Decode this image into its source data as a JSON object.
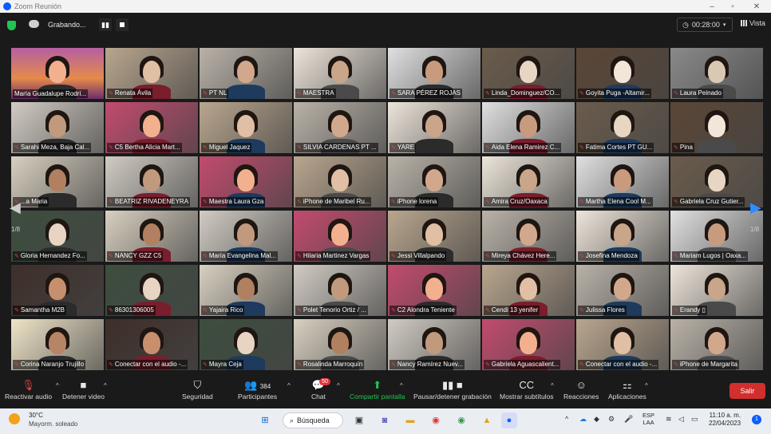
{
  "window": {
    "title": "Zoom Reunión"
  },
  "topbar": {
    "recording_label": "Grabando...",
    "pause_icon": "▮▮",
    "timer": "00:28:00",
    "view_label": "Vista"
  },
  "pager": {
    "left": "1/8",
    "right": "1/8"
  },
  "participants": [
    "María Guadalupe Rodrí...",
    "Renata Ávila",
    "PT NL",
    "MAESTRA",
    "SARA PÉREZ ROJAS",
    "Linda_Dominguez/CO...",
    "Goyita Puga -Altamir...",
    "Laura Peinado",
    "Sarahi Meza, Baja Cal...",
    "C5 Bertha Alicia Mart...",
    "Miguel Jaquez",
    "SILVIA CARDENAS PT ...",
    "YARE",
    "Aida Elena Ramirez C...",
    "Fatima Cortes PT  GU...",
    "Pina",
    "...a Maria",
    "BEATRIZ RIVADENEYRA",
    "Maestra Laura Gza",
    "iPhone de Maribel Ru...",
    "iPhone lorena",
    "Amira Cruz/Oaxaca",
    "Martha Elena Cool M...",
    "Gabriela Cruz Gutier...",
    "Gloria Hernandez Fo...",
    "NANCY GZZ C5",
    "María Evangelina Mal...",
    "Hilaria Martinez Vargas",
    "Jessi Villalpando",
    "Mireya Chávez  Here...",
    "Josefina Mendoza",
    "Mariam Lugos | Oaxa...",
    "Samantha M2B",
    "86301306005",
    "Yajaira Rico",
    "Polet Tenorio Ortiz / ...",
    "C2 Alondra Teniente",
    "Cendi 13 yenifer",
    "Julissa Flores",
    "Erandy ▯",
    "Corina Naranjo Trujillo",
    "Conectar con el audio -...",
    "Mayra Ceja",
    "Rosalinda Marroquín",
    "Nancy Ramírez Nuev...",
    "Gabriela Aguascalient...",
    "Conectar con el audio -...",
    "iPhone de Margarita"
  ],
  "toolbar": {
    "unmute": "Reactivar audio",
    "video": "Detener video",
    "security": "Seguridad",
    "participants": "Participantes",
    "participants_count": "384",
    "chat": "Chat",
    "chat_badge": "50",
    "share": "Compartir pantalla",
    "record": "Pausar/detener grabación",
    "captions": "Mostrar subtítulos",
    "reactions": "Reacciones",
    "apps": "Aplicaciones",
    "leave": "Salir"
  },
  "taskbar": {
    "weather_temp": "30°C",
    "weather_desc": "Mayorm. soleado",
    "search": "Búsqueda",
    "lang_1": "ESP",
    "lang_2": "LAA",
    "time": "11:10 a. m.",
    "date": "22/04/2023",
    "notifications": "1"
  }
}
